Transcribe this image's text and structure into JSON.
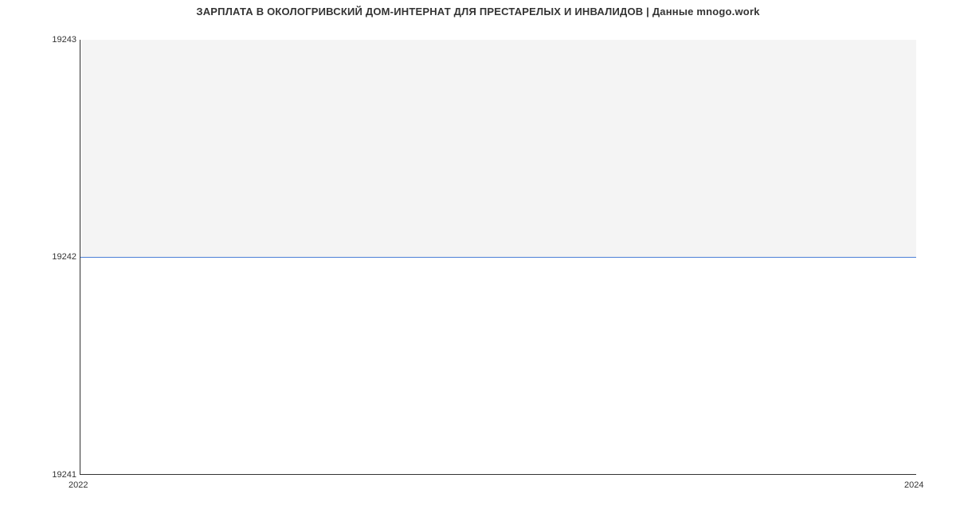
{
  "chart_data": {
    "type": "area",
    "title": "ЗАРПЛАТА В ОКОЛОГРИВСКИЙ ДОМ-ИНТЕРНАТ ДЛЯ ПРЕСТАРЕЛЫХ И ИНВАЛИДОВ | Данные mnogo.work",
    "x": [
      2022,
      2024
    ],
    "values": [
      19242,
      19242
    ],
    "xlabel": "",
    "ylabel": "",
    "ylim": [
      19241,
      19243
    ],
    "xlim": [
      2022,
      2024
    ],
    "y_ticks": [
      19241,
      19242,
      19243
    ],
    "x_ticks": [
      2022,
      2024
    ],
    "line_color": "#4a7fd6",
    "fill_color": "#f4f4f4"
  }
}
